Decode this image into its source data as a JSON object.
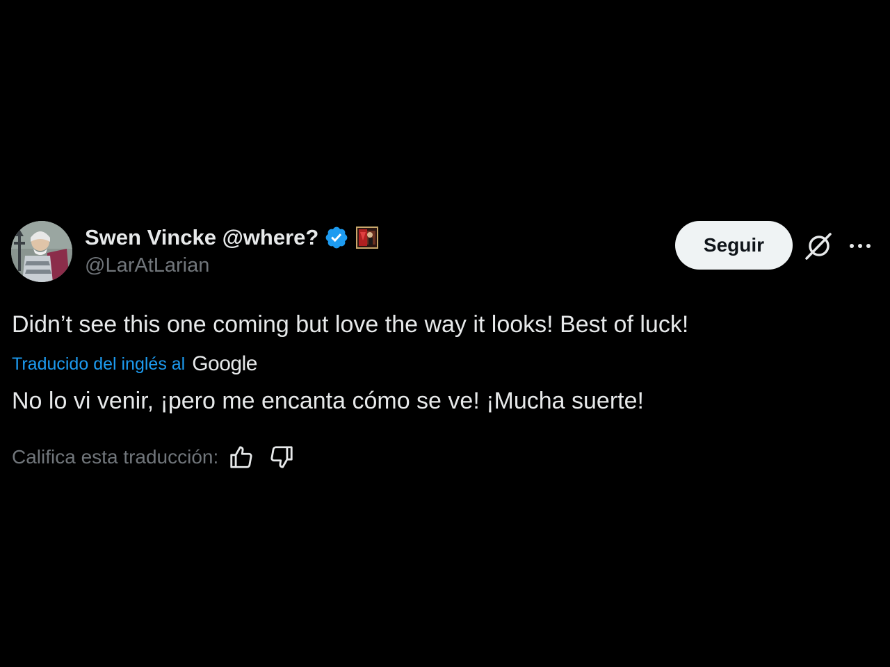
{
  "tweet": {
    "author": {
      "display_name": "Swen Vincke @where?",
      "handle": "@LarAtLarian",
      "verified": true,
      "avatar_icon": "avatar-knight-illustration",
      "affiliate_icon": "larian-badge-icon"
    },
    "follow_label": "Seguir",
    "text": "Didn’t see this one coming but love the way it looks! Best of luck!",
    "translation": {
      "label": "Traducido del inglés al",
      "provider": "Google",
      "text": "No lo vi venir, ¡pero me encanta cómo se ve! ¡Mucha suerte!",
      "rate_label": "Califica esta traducción:"
    }
  },
  "colors": {
    "background": "#000000",
    "primary_text": "#e7e9ea",
    "secondary_text": "#71767b",
    "link": "#1d9bf0",
    "verified": "#1d9bf0",
    "follow_bg": "#eff3f4",
    "follow_text": "#0f1419"
  },
  "icons": {
    "verified": "verified-badge-icon",
    "grok": "grok-icon",
    "more": "more-options-icon",
    "thumbs_up": "thumbs-up-icon",
    "thumbs_down": "thumbs-down-icon"
  }
}
